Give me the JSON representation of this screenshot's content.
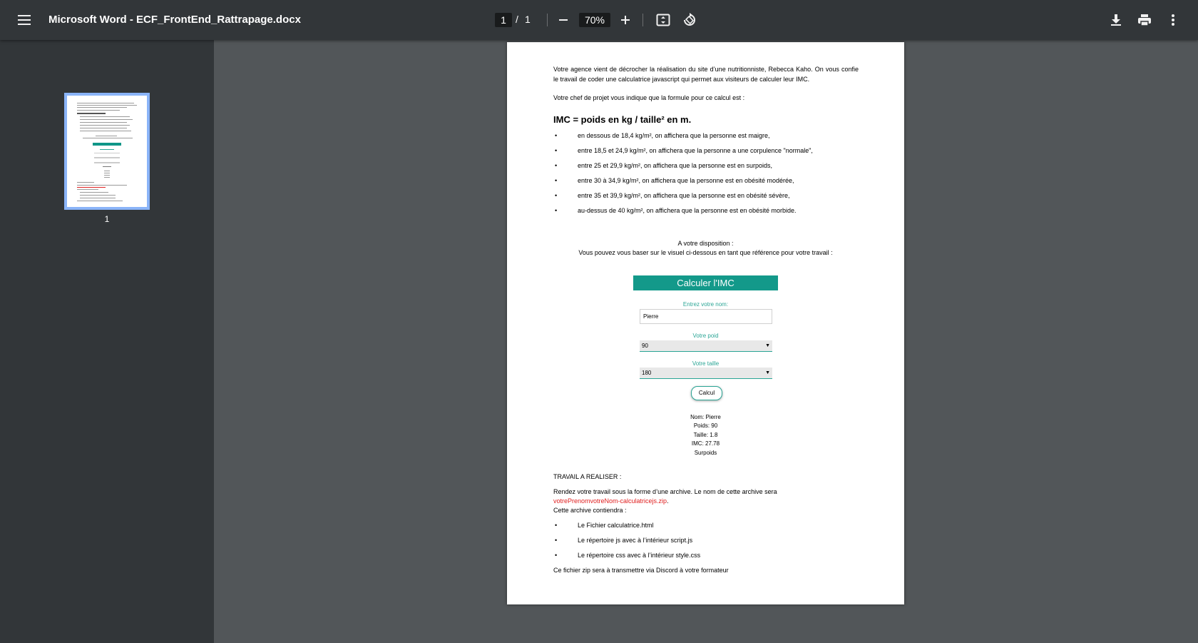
{
  "toolbar": {
    "title": "Microsoft Word - ECF_FrontEnd_Rattrapage.docx",
    "current_page": "1",
    "separator": "/",
    "total_pages": "1",
    "zoom": "70%",
    "icons": [
      "menu-icon",
      "zoom-out-icon",
      "zoom-in-icon",
      "fit-page-icon",
      "rotate-icon",
      "download-icon",
      "print-icon",
      "more-vert-icon"
    ]
  },
  "sidebar": {
    "thumbnail_label": "1"
  },
  "document": {
    "intro": "Votre agence vient de décrocher la réalisation du site d’une nutritionniste, Rebecca Kaho. On vous confie le travail de coder une calculatrice javascript qui permet aux visiteurs de calculer leur IMC.",
    "formula_intro": "Votre chef de projet vous indique que la formule pour ce calcul est :",
    "formula": "IMC = poids en kg / taille² en m.",
    "bullets": [
      "en dessous de 18,4 kg/m², on affichera que la personne est maigre,",
      "entre 18,5 et 24,9 kg/m², on affichera que la personne a une corpulence \"normale\",",
      "entre 25 et 29,9 kg/m², on affichera que la personne est en surpoids,",
      "entre 30 à 34,9 kg/m², on affichera que la personne est en obésité modérée,",
      "entre 35 et 39,9 kg/m², on affichera que la personne est en obésité sévère,",
      "au-dessus de 40 kg/m², on affichera que la personne est en obésité morbide."
    ],
    "disposition_title": "A votre disposition :",
    "disposition_text": "Vous pouvez vous baser sur le visuel ci-dessous en tant que référence pour votre travail :",
    "calc": {
      "header": "Calculer l'IMC",
      "name_label": "Entrez votre nom:",
      "name_value": "Pierre",
      "weight_label": "Votre poid",
      "weight_value": "90",
      "height_label": "Votre taille",
      "height_value": "180",
      "button": "Calcul",
      "results": [
        "Nom: Pierre",
        "Poids: 90",
        "Taille: 1.8",
        "IMC: 27.78",
        "Surpoids"
      ]
    },
    "work_title": "TRAVAIL A REALISER :",
    "work_text": "Rendez votre travail sous la forme d’une archive. Le nom de cette archive sera",
    "archive_name": "votrePrenomvotreNom-calculatricejs.zip",
    "archive_period": ".",
    "archive_contains": "Cette archive contiendra :",
    "archive_items": [
      "Le Fichier calculatrice.html",
      "Le répertoire js avec à l’intérieur script.js",
      "Le répertoire css avec à l’intérieur style.css"
    ],
    "closing": "Ce fichier zip sera à transmettre via Discord à votre formateur",
    "bullet_char": "•"
  }
}
